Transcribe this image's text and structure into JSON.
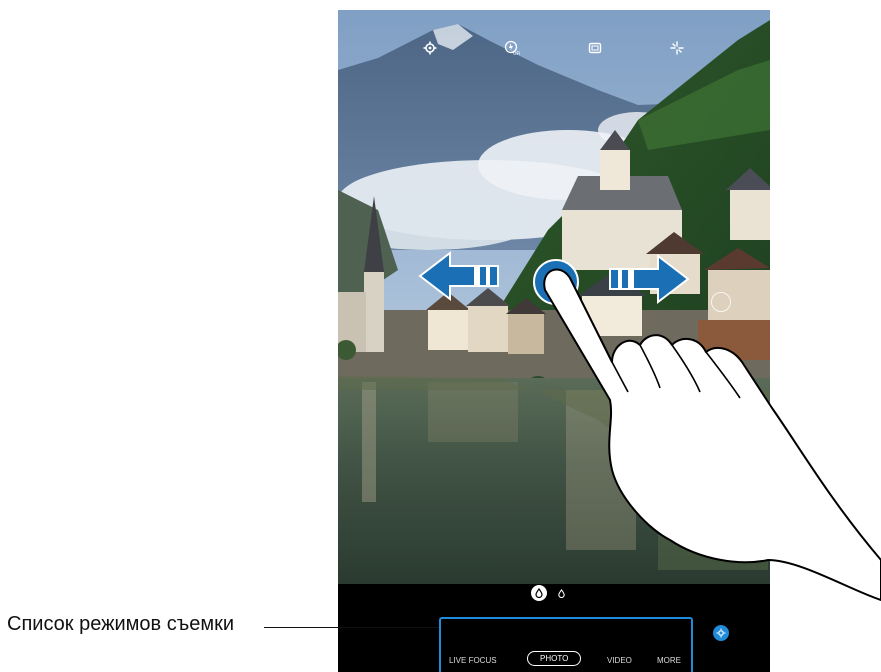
{
  "callout": {
    "label": "Список режимов съемки"
  },
  "camera": {
    "top_icons": [
      {
        "name": "settings-icon",
        "glyph": "⚙"
      },
      {
        "name": "flash-off-icon",
        "glyph": "⚡"
      },
      {
        "name": "aspect-ratio-icon",
        "glyph": "▭"
      },
      {
        "name": "effects-icon",
        "glyph": "✧"
      }
    ],
    "filter_toggle": {
      "selected_icon": "filter-drop-icon",
      "other_icon": "filter-drop-small-icon"
    },
    "modes": [
      {
        "label": "LIVE FOCUS"
      },
      {
        "label": "PHOTO"
      },
      {
        "label": "VIDEO"
      },
      {
        "label": "MORE"
      }
    ],
    "selected_mode_index": 1,
    "quick_settings_icon": "gear-small-icon"
  },
  "gesture": {
    "type": "swipe-left-right",
    "arrow_left": "arrow-left-icon",
    "arrow_right": "arrow-right-icon"
  },
  "colors": {
    "accent": "#1f8bd9",
    "arrow": "#1a6fb5"
  }
}
